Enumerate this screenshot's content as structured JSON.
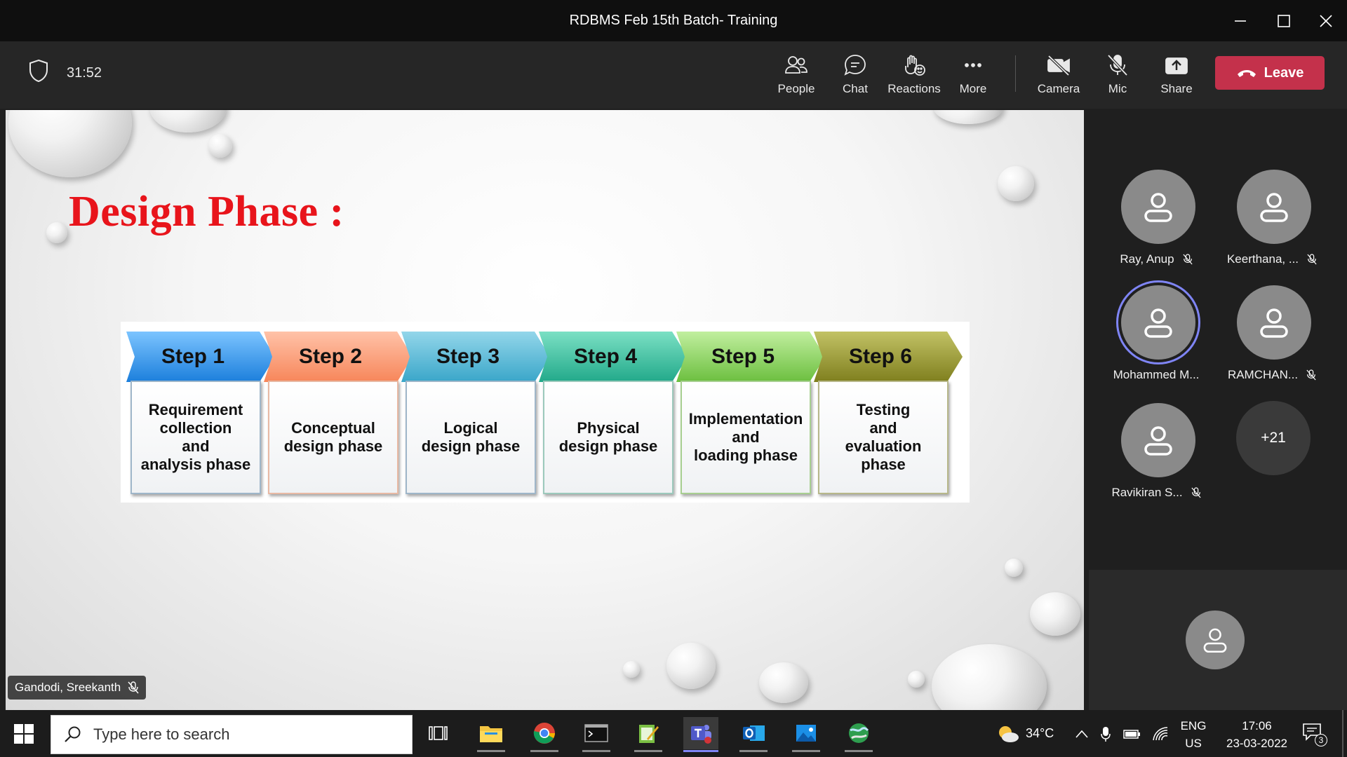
{
  "window": {
    "title": "RDBMS Feb 15th Batch- Training"
  },
  "toolbar": {
    "timer": "31:52",
    "buttons": [
      {
        "label": "People",
        "icon": "people-icon"
      },
      {
        "label": "Chat",
        "icon": "chat-icon"
      },
      {
        "label": "Reactions",
        "icon": "reactions-icon"
      },
      {
        "label": "More",
        "icon": "more-icon"
      },
      {
        "label": "Camera",
        "icon": "camera-off-icon"
      },
      {
        "label": "Mic",
        "icon": "mic-off-icon"
      },
      {
        "label": "Share",
        "icon": "share-icon"
      }
    ],
    "leave_label": "Leave",
    "leave_color": "#c4314b"
  },
  "slide": {
    "title": "Design Phase :",
    "title_color": "#e8141b",
    "steps": [
      {
        "label": "Step 1",
        "text": "Requirement\ncollection\nand\nanalysis phase",
        "color": "#3d9be9"
      },
      {
        "label": "Step 2",
        "text": "Conceptual\ndesign phase",
        "color": "#f7a07c"
      },
      {
        "label": "Step 3",
        "text": "Logical\ndesign phase",
        "color": "#5bbad5"
      },
      {
        "label": "Step 4",
        "text": "Physical\ndesign phase",
        "color": "#3cc2a3"
      },
      {
        "label": "Step 5",
        "text": "Implementation\nand\nloading phase",
        "color": "#8fd16a"
      },
      {
        "label": "Step 6",
        "text": "Testing\nand\nevaluation\nphase",
        "color": "#9a9a2e"
      }
    ]
  },
  "presenter": {
    "name": "Gandodi, Sreekanth"
  },
  "participants": [
    {
      "name": "Ray, Anup",
      "muted": true,
      "speaking": false
    },
    {
      "name": "Keerthana, ...",
      "muted": true,
      "speaking": false
    },
    {
      "name": "Mohammed M...",
      "muted": false,
      "speaking": true
    },
    {
      "name": "RAMCHAN...",
      "muted": true,
      "speaking": false
    },
    {
      "name": "Ravikiran S...",
      "muted": true,
      "speaking": false
    }
  ],
  "more_participants": "+21",
  "taskbar": {
    "search_placeholder": "Type here to search",
    "weather": "34°C",
    "lang_line1": "ENG",
    "lang_line2": "US",
    "time": "17:06",
    "date": "23-03-2022",
    "notifications": "3"
  }
}
